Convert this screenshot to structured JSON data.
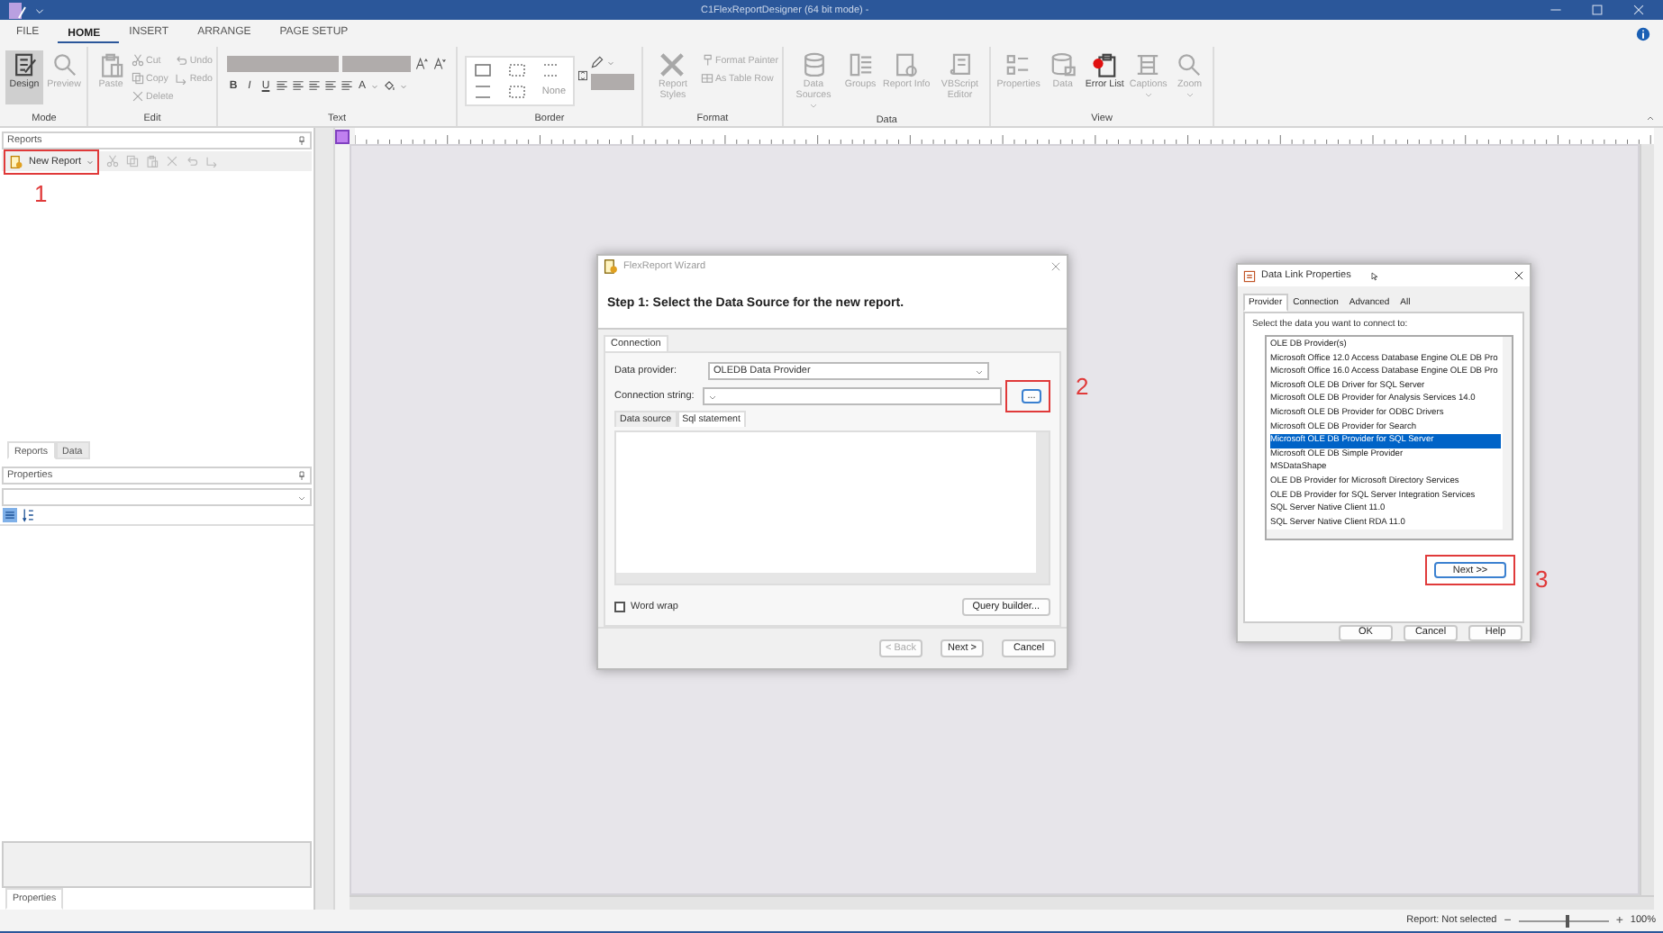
{
  "window": {
    "title": "C1FlexReportDesigner (64 bit mode) -"
  },
  "menu_tabs": [
    {
      "label": "FILE",
      "selected": false
    },
    {
      "label": "HOME",
      "selected": true
    },
    {
      "label": "INSERT",
      "selected": false
    },
    {
      "label": "ARRANGE",
      "selected": false
    },
    {
      "label": "PAGE SETUP",
      "selected": false
    }
  ],
  "ribbon": {
    "groups": [
      {
        "kind": "buttons",
        "label": "Mode",
        "items": [
          {
            "kind": "large",
            "label": "Design",
            "disabled": false,
            "selected": true
          },
          {
            "kind": "large",
            "label": "Preview",
            "disabled": true,
            "selected": false
          }
        ]
      },
      {
        "kind": "buttons",
        "label": "Edit",
        "items": [
          {
            "kind": "large",
            "label": "Paste",
            "disabled": true
          },
          {
            "kind": "stack",
            "items": [
              {
                "label": "Cut",
                "disabled": true
              },
              {
                "label": "Copy",
                "disabled": true
              },
              {
                "label": "Delete",
                "disabled": true
              }
            ]
          },
          {
            "kind": "stack",
            "items": [
              {
                "label": "Undo",
                "disabled": true
              },
              {
                "label": "Redo",
                "disabled": true
              }
            ]
          }
        ]
      },
      {
        "kind": "text",
        "label": "Text",
        "styles": [
          "B",
          "I",
          "U"
        ],
        "font_color": "A"
      },
      {
        "kind": "border",
        "label": "Border",
        "none_label": "None"
      },
      {
        "kind": "buttons",
        "label": "Format",
        "items": [
          {
            "kind": "large",
            "label": "Report Styles",
            "disabled": true
          },
          {
            "kind": "stack",
            "items": [
              {
                "label": "Format Painter",
                "disabled": true
              },
              {
                "label": "As Table Row",
                "disabled": true
              }
            ]
          }
        ]
      },
      {
        "kind": "buttons",
        "label": "Data",
        "items": [
          {
            "kind": "large",
            "label": "Data Sources",
            "disabled": true,
            "dropdown": true
          },
          {
            "kind": "large",
            "label": "Groups",
            "disabled": true
          },
          {
            "kind": "large",
            "label": "Report Info",
            "disabled": true
          },
          {
            "kind": "large",
            "label": "VBScript Editor",
            "disabled": true
          }
        ]
      },
      {
        "kind": "buttons",
        "label": "View",
        "items": [
          {
            "kind": "large",
            "label": "Properties",
            "disabled": true
          },
          {
            "kind": "large",
            "label": "Data",
            "disabled": true
          },
          {
            "kind": "large",
            "label": "Error List",
            "disabled": false
          },
          {
            "kind": "large",
            "label": "Captions",
            "disabled": true,
            "dropdown": true
          },
          {
            "kind": "large",
            "label": "Zoom",
            "disabled": true,
            "dropdown": true
          }
        ]
      }
    ]
  },
  "reports_panel": {
    "title": "Reports",
    "new_report": "New Report"
  },
  "panel_tabs": [
    {
      "label": "Reports",
      "selected": true
    },
    {
      "label": "Data",
      "selected": false
    }
  ],
  "properties_panel": {
    "title": "Properties"
  },
  "bottom_tabs": [
    {
      "label": "Properties",
      "selected": true
    }
  ],
  "wizard": {
    "title": "FlexReport Wizard",
    "heading": "Step 1: Select the Data Source for the new report.",
    "tab": "Connection",
    "provider_label": "Data provider:",
    "provider_value": "OLEDB Data Provider",
    "connection_label": "Connection string:",
    "browse": "...",
    "sub_tabs": [
      {
        "label": "Data source",
        "selected": false
      },
      {
        "label": "Sql statement",
        "selected": true
      }
    ],
    "word_wrap": {
      "label": "Word wrap",
      "checked": false
    },
    "query_builder": "Query builder...",
    "buttons": [
      {
        "label": "< Back",
        "disabled": true
      },
      {
        "label": "Next >",
        "disabled": false
      },
      {
        "label": "Cancel",
        "disabled": false
      }
    ]
  },
  "data_link": {
    "title": "Data Link Properties",
    "tabs": [
      {
        "label": "Provider",
        "selected": true
      },
      {
        "label": "Connection",
        "selected": false
      },
      {
        "label": "Advanced",
        "selected": false
      },
      {
        "label": "All",
        "selected": false
      }
    ],
    "prompt": "Select the data you want to connect to:",
    "providers": [
      {
        "label": "OLE DB Provider(s)",
        "selected": false
      },
      {
        "label": "Microsoft Office 12.0 Access Database Engine OLE DB Pro",
        "selected": false
      },
      {
        "label": "Microsoft Office 16.0 Access Database Engine OLE DB Pro",
        "selected": false
      },
      {
        "label": "Microsoft OLE DB Driver for SQL Server",
        "selected": false
      },
      {
        "label": "Microsoft OLE DB Provider for Analysis Services 14.0",
        "selected": false
      },
      {
        "label": "Microsoft OLE DB Provider for ODBC Drivers",
        "selected": false
      },
      {
        "label": "Microsoft OLE DB Provider for Search",
        "selected": false
      },
      {
        "label": "Microsoft OLE DB Provider for SQL Server",
        "selected": true
      },
      {
        "label": "Microsoft OLE DB Simple Provider",
        "selected": false
      },
      {
        "label": "MSDataShape",
        "selected": false
      },
      {
        "label": "OLE DB Provider for Microsoft Directory Services",
        "selected": false
      },
      {
        "label": "OLE DB Provider for SQL Server Integration Services",
        "selected": false
      },
      {
        "label": "SQL Server Native Client 11.0",
        "selected": false
      },
      {
        "label": "SQL Server Native Client RDA 11.0",
        "selected": false
      }
    ],
    "next": "Next >>",
    "buttons": [
      "OK",
      "Cancel",
      "Help"
    ]
  },
  "annotations": [
    {
      "label": "1"
    },
    {
      "label": "2"
    },
    {
      "label": "3"
    }
  ],
  "status_bar": {
    "text": "Report: Not selected",
    "zoom_out": "−",
    "zoom_in": "+",
    "zoom": {
      "level": 0.55
    },
    "zoom_reading": "100%"
  }
}
